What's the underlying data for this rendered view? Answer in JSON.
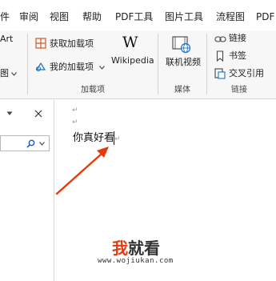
{
  "menu": {
    "tabs": [
      "件",
      "审阅",
      "视图",
      "帮助",
      "PDF工具",
      "图片工具",
      "流程图",
      "PDF"
    ]
  },
  "ribbon": {
    "left_partial": {
      "art": "Art",
      "tu": "图"
    },
    "addins": {
      "get_addins": "获取加载项",
      "my_addins": "我的加载项",
      "wikipedia_glyph": "W",
      "wikipedia": "Wikipedia",
      "group_label": "加载项"
    },
    "media": {
      "online_video": "联机视频",
      "group_label": "媒体"
    },
    "links": {
      "link": "链接",
      "bookmark": "书签",
      "cross_ref": "交叉引用",
      "group_label": "链接"
    }
  },
  "document": {
    "text": "你真好看",
    "para_mark": "↵"
  },
  "watermark": {
    "logo_red": "我",
    "logo_dark": "就看",
    "url": "www.wojiukan.com"
  },
  "colors": {
    "accent": "#e8380d",
    "link_blue": "#1a73c8"
  }
}
